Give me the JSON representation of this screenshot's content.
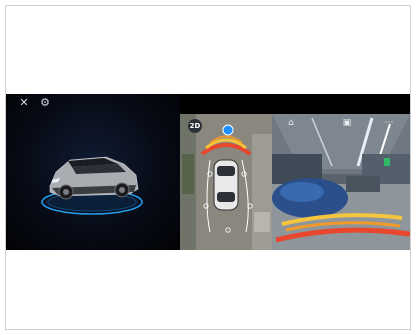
{
  "controls": {
    "close_icon": "close-icon",
    "settings_icon": "gear-icon"
  },
  "topdown": {
    "mode_label": "2D"
  },
  "rear_camera": {
    "icons": [
      "home-icon",
      "camera-icon",
      "dots-icon"
    ]
  },
  "colors": {
    "accent": "#1e90ff",
    "parking_red": "#e8472d",
    "parking_yellow": "#f4c63d"
  }
}
